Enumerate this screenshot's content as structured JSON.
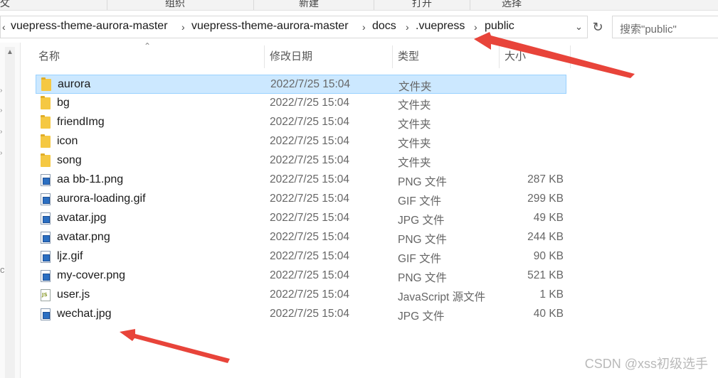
{
  "ribbon": {
    "items": [
      "组织",
      "新建",
      "打开",
      "选择"
    ],
    "left_fragment": "攵"
  },
  "address": {
    "back_chevron": "‹",
    "crumbs": [
      "vuepress-theme-aurora-master",
      "vuepress-theme-aurora-master",
      "docs",
      ".vuepress",
      "public"
    ],
    "separator": "›"
  },
  "search": {
    "placeholder": "搜索\"public\""
  },
  "columns": {
    "name": "名称",
    "date": "修改日期",
    "type": "类型",
    "size": "大小"
  },
  "files": [
    {
      "name": "aurora",
      "date": "2022/7/25 15:04",
      "type": "文件夹",
      "size": "",
      "icon": "folder-icon",
      "selected": true
    },
    {
      "name": "bg",
      "date": "2022/7/25 15:04",
      "type": "文件夹",
      "size": "",
      "icon": "folder-icon"
    },
    {
      "name": "friendImg",
      "date": "2022/7/25 15:04",
      "type": "文件夹",
      "size": "",
      "icon": "folder-icon"
    },
    {
      "name": "icon",
      "date": "2022/7/25 15:04",
      "type": "文件夹",
      "size": "",
      "icon": "folder-icon"
    },
    {
      "name": "song",
      "date": "2022/7/25 15:04",
      "type": "文件夹",
      "size": "",
      "icon": "folder-icon"
    },
    {
      "name": "aa bb-11.png",
      "date": "2022/7/25 15:04",
      "type": "PNG 文件",
      "size": "287 KB",
      "icon": "image-icon"
    },
    {
      "name": "aurora-loading.gif",
      "date": "2022/7/25 15:04",
      "type": "GIF 文件",
      "size": "299 KB",
      "icon": "image-icon"
    },
    {
      "name": "avatar.jpg",
      "date": "2022/7/25 15:04",
      "type": "JPG 文件",
      "size": "49 KB",
      "icon": "image-icon"
    },
    {
      "name": "avatar.png",
      "date": "2022/7/25 15:04",
      "type": "PNG 文件",
      "size": "244 KB",
      "icon": "image-icon"
    },
    {
      "name": "ljz.gif",
      "date": "2022/7/25 15:04",
      "type": "GIF 文件",
      "size": "90 KB",
      "icon": "image-icon"
    },
    {
      "name": "my-cover.png",
      "date": "2022/7/25 15:04",
      "type": "PNG 文件",
      "size": "521 KB",
      "icon": "image-icon"
    },
    {
      "name": "user.js",
      "date": "2022/7/25 15:04",
      "type": "JavaScript 源文件",
      "size": "1 KB",
      "icon": "js-icon"
    },
    {
      "name": "wechat.jpg",
      "date": "2022/7/25 15:04",
      "type": "JPG 文件",
      "size": "40 KB",
      "icon": "image-icon"
    }
  ],
  "watermark": "CSDN @xss初级选手",
  "colors": {
    "selection": "#cce8ff",
    "selection_border": "#99d1ff",
    "annotation_arrow": "#e8443a"
  }
}
